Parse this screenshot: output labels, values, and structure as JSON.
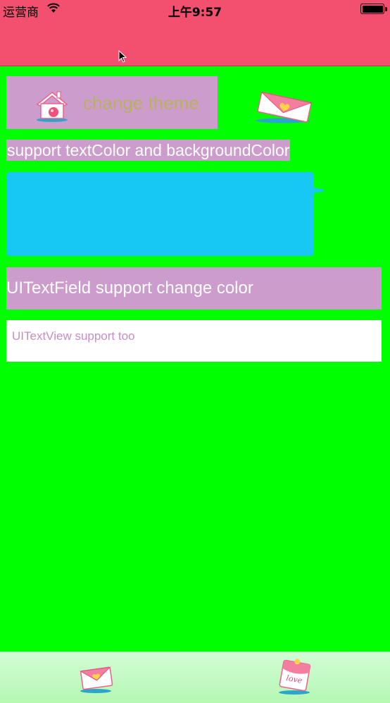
{
  "status_bar": {
    "carrier": "运营商",
    "time": "上午9:57",
    "battery_level": 1.0,
    "colors": {
      "background": "#f2506e"
    }
  },
  "main": {
    "background_color": "#00ff00",
    "change_theme_button": {
      "label": "change theme",
      "icon": "house-icon"
    },
    "envelope_image": {
      "icon": "envelope-icon"
    },
    "support_label": {
      "text": "support textColor and backgroundColor"
    },
    "bubble": {
      "color": "#17c8f5"
    },
    "text_field": {
      "value": "UITextField support change color",
      "color": "#cc9ccc"
    },
    "text_view": {
      "value": "UITextView support too"
    }
  },
  "tab_bar": {
    "items": [
      {
        "icon": "envelope-tab-icon"
      },
      {
        "icon": "love-note-tab-icon"
      }
    ]
  }
}
